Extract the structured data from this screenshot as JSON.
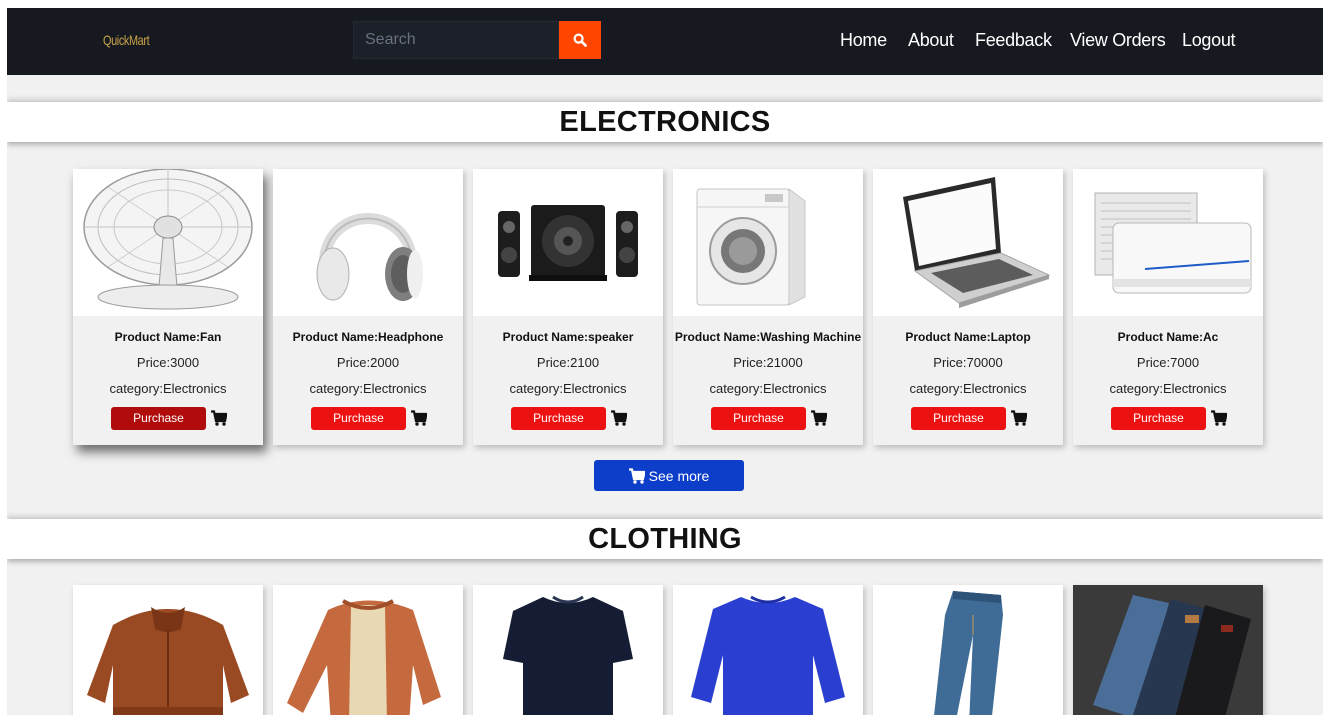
{
  "brand": {
    "logo_text": "QuickMart"
  },
  "search": {
    "placeholder": "Search"
  },
  "nav": {
    "items": [
      "Home",
      "About",
      "Feedback",
      "View Orders",
      "Logout"
    ]
  },
  "sections": [
    {
      "title": "ELECTRONICS",
      "products": [
        {
          "name": "Product Name:Fan",
          "price": "Price:3000",
          "category": "category:Electronics",
          "image": "fan"
        },
        {
          "name": "Product Name:Headphone",
          "price": "Price:2000",
          "category": "category:Electronics",
          "image": "headphone"
        },
        {
          "name": "Product Name:speaker",
          "price": "Price:2100",
          "category": "category:Electronics",
          "image": "speaker"
        },
        {
          "name": "Product Name:Washing Machine",
          "price": "Price:21000",
          "category": "category:Electronics",
          "image": "washing-machine"
        },
        {
          "name": "Product Name:Laptop",
          "price": "Price:70000",
          "category": "category:Electronics",
          "image": "laptop"
        },
        {
          "name": "Product Name:Ac",
          "price": "Price:7000",
          "category": "category:Electronics",
          "image": "ac"
        }
      ],
      "purchase_label": "Purchase",
      "see_more_label": "See more"
    },
    {
      "title": "CLOTHING",
      "products": [
        {
          "image": "leather-jacket"
        },
        {
          "image": "bomber-jacket"
        },
        {
          "image": "tshirt"
        },
        {
          "image": "sweatshirt"
        },
        {
          "image": "jeans"
        },
        {
          "image": "jeans-stack"
        }
      ]
    }
  ],
  "colors": {
    "navbar": "#161a20",
    "logo": "#c9a24a",
    "search_button": "#ff4500",
    "purchase_button": "#ee1111",
    "see_more_button": "#0d3ec9"
  }
}
